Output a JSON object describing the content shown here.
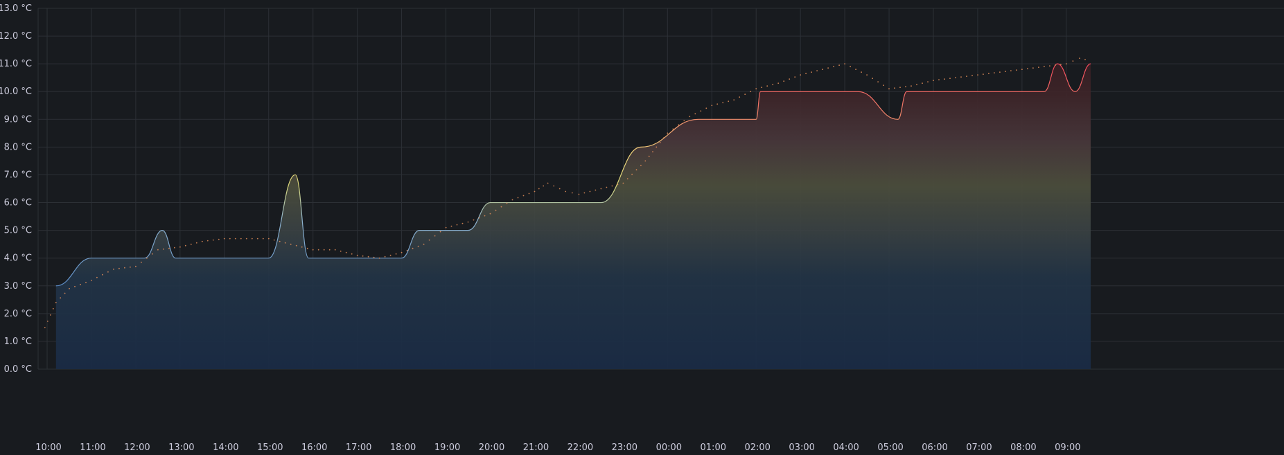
{
  "chart_data": {
    "type": "area",
    "title": "",
    "xlabel": "",
    "ylabel": "",
    "ylim": [
      0,
      13
    ],
    "y_ticks": [
      {
        "value": 0,
        "label": "0.0 °C"
      },
      {
        "value": 1,
        "label": "1.0 °C"
      },
      {
        "value": 2,
        "label": "2.0 °C"
      },
      {
        "value": 3,
        "label": "3.0 °C"
      },
      {
        "value": 4,
        "label": "4.0 °C"
      },
      {
        "value": 5,
        "label": "5.0 °C"
      },
      {
        "value": 6,
        "label": "6.0 °C"
      },
      {
        "value": 7,
        "label": "7.0 °C"
      },
      {
        "value": 8,
        "label": "8.0 °C"
      },
      {
        "value": 9,
        "label": "9.0 °C"
      },
      {
        "value": 10,
        "label": "10.0 °C"
      },
      {
        "value": 11,
        "label": "11.0 °C"
      },
      {
        "value": 12,
        "label": "12.0 °C"
      },
      {
        "value": 13,
        "label": "13.0 °C"
      }
    ],
    "x_start": "10:00",
    "x_range_hours": [
      0,
      23.55
    ],
    "x_ticks": [
      {
        "hour": 0,
        "label": "10:00"
      },
      {
        "hour": 1,
        "label": "11:00"
      },
      {
        "hour": 2,
        "label": "12:00"
      },
      {
        "hour": 3,
        "label": "13:00"
      },
      {
        "hour": 4,
        "label": "14:00"
      },
      {
        "hour": 5,
        "label": "15:00"
      },
      {
        "hour": 6,
        "label": "16:00"
      },
      {
        "hour": 7,
        "label": "17:00"
      },
      {
        "hour": 8,
        "label": "18:00"
      },
      {
        "hour": 9,
        "label": "19:00"
      },
      {
        "hour": 10,
        "label": "20:00"
      },
      {
        "hour": 11,
        "label": "21:00"
      },
      {
        "hour": 12,
        "label": "22:00"
      },
      {
        "hour": 13,
        "label": "23:00"
      },
      {
        "hour": 14,
        "label": "00:00"
      },
      {
        "hour": 15,
        "label": "01:00"
      },
      {
        "hour": 16,
        "label": "02:00"
      },
      {
        "hour": 17,
        "label": "03:00"
      },
      {
        "hour": 18,
        "label": "04:00"
      },
      {
        "hour": 19,
        "label": "05:00"
      },
      {
        "hour": 20,
        "label": "06:00"
      },
      {
        "hour": 21,
        "label": "07:00"
      },
      {
        "hour": 22,
        "label": "08:00"
      },
      {
        "hour": 23,
        "label": "09:00"
      }
    ],
    "grid": true,
    "legend": "none",
    "series": [
      {
        "style": "area-smooth",
        "color_gradient": [
          "#6b9fd1",
          "#d8d67a",
          "#f2495c"
        ],
        "x_hours": [
          0.2,
          1.0,
          1.3,
          2.2,
          2.6,
          2.9,
          3.0,
          5.0,
          5.6,
          5.9,
          6.0,
          8.0,
          8.4,
          9.5,
          10.0,
          12.5,
          13.4,
          14.7,
          15.2,
          16.0,
          16.1,
          18.3,
          19.2,
          19.4,
          22.5,
          22.8,
          23.2,
          23.55
        ],
        "values": [
          3.0,
          4.0,
          4.0,
          4.0,
          5.0,
          4.0,
          4.0,
          4.0,
          7.0,
          4.0,
          4.0,
          4.0,
          5.0,
          5.0,
          6.0,
          6.0,
          8.0,
          9.0,
          9.0,
          9.0,
          10.0,
          10.0,
          9.0,
          10.0,
          10.0,
          11.0,
          10.0,
          11.0
        ]
      },
      {
        "style": "dotted",
        "color": "#e8915a",
        "x_hours": [
          -0.05,
          0.2,
          0.5,
          1.0,
          1.5,
          2.0,
          2.5,
          3.0,
          3.5,
          4.0,
          4.5,
          5.0,
          5.5,
          6.0,
          6.5,
          7.0,
          7.5,
          8.0,
          8.5,
          9.0,
          9.5,
          10.0,
          10.5,
          11.0,
          11.3,
          11.7,
          12.0,
          12.5,
          13.0,
          13.5,
          14.0,
          14.5,
          15.0,
          15.5,
          16.0,
          16.5,
          17.0,
          17.5,
          18.0,
          18.5,
          19.0,
          19.5,
          20.0,
          20.5,
          21.0,
          21.5,
          22.0,
          22.5,
          23.0,
          23.3,
          23.55
        ],
        "values": [
          1.5,
          2.4,
          2.9,
          3.2,
          3.6,
          3.7,
          4.3,
          4.4,
          4.6,
          4.7,
          4.7,
          4.7,
          4.5,
          4.3,
          4.3,
          4.1,
          4.0,
          4.2,
          4.5,
          5.1,
          5.3,
          5.6,
          6.1,
          6.4,
          6.7,
          6.4,
          6.3,
          6.5,
          6.7,
          7.5,
          8.5,
          9.1,
          9.5,
          9.7,
          10.1,
          10.3,
          10.6,
          10.8,
          11.0,
          10.6,
          10.1,
          10.2,
          10.4,
          10.5,
          10.6,
          10.7,
          10.8,
          10.9,
          11.0,
          11.2,
          11.1
        ]
      }
    ]
  }
}
